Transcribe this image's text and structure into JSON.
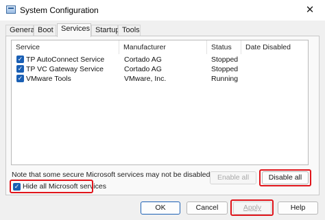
{
  "window": {
    "title": "System Configuration",
    "close_glyph": "✕"
  },
  "tabs": [
    {
      "label": "General"
    },
    {
      "label": "Boot"
    },
    {
      "label": "Services"
    },
    {
      "label": "Startup"
    },
    {
      "label": "Tools"
    }
  ],
  "active_tab": "Services",
  "table": {
    "columns": [
      "Service",
      "Manufacturer",
      "Status",
      "Date Disabled"
    ],
    "rows": [
      {
        "checked": true,
        "service": "TP AutoConnect Service",
        "manufacturer": "Cortado AG",
        "status": "Stopped",
        "date_disabled": ""
      },
      {
        "checked": true,
        "service": "TP VC Gateway Service",
        "manufacturer": "Cortado AG",
        "status": "Stopped",
        "date_disabled": ""
      },
      {
        "checked": true,
        "service": "VMware Tools",
        "manufacturer": "VMware, Inc.",
        "status": "Running",
        "date_disabled": ""
      }
    ]
  },
  "note": "Note that some secure Microsoft services may not be disabled.",
  "buttons": {
    "enable_all": "Enable all",
    "disable_all": "Disable all",
    "ok": "OK",
    "cancel": "Cancel",
    "apply": "Apply",
    "help": "Help"
  },
  "hide_microsoft": {
    "label": "Hide all Microsoft services",
    "checked": true
  },
  "colors": {
    "accent": "#1a5fb4",
    "highlight": "#e0141a"
  },
  "icons": {
    "checkbox": "checkmark-icon",
    "app": "system-configuration-icon"
  }
}
